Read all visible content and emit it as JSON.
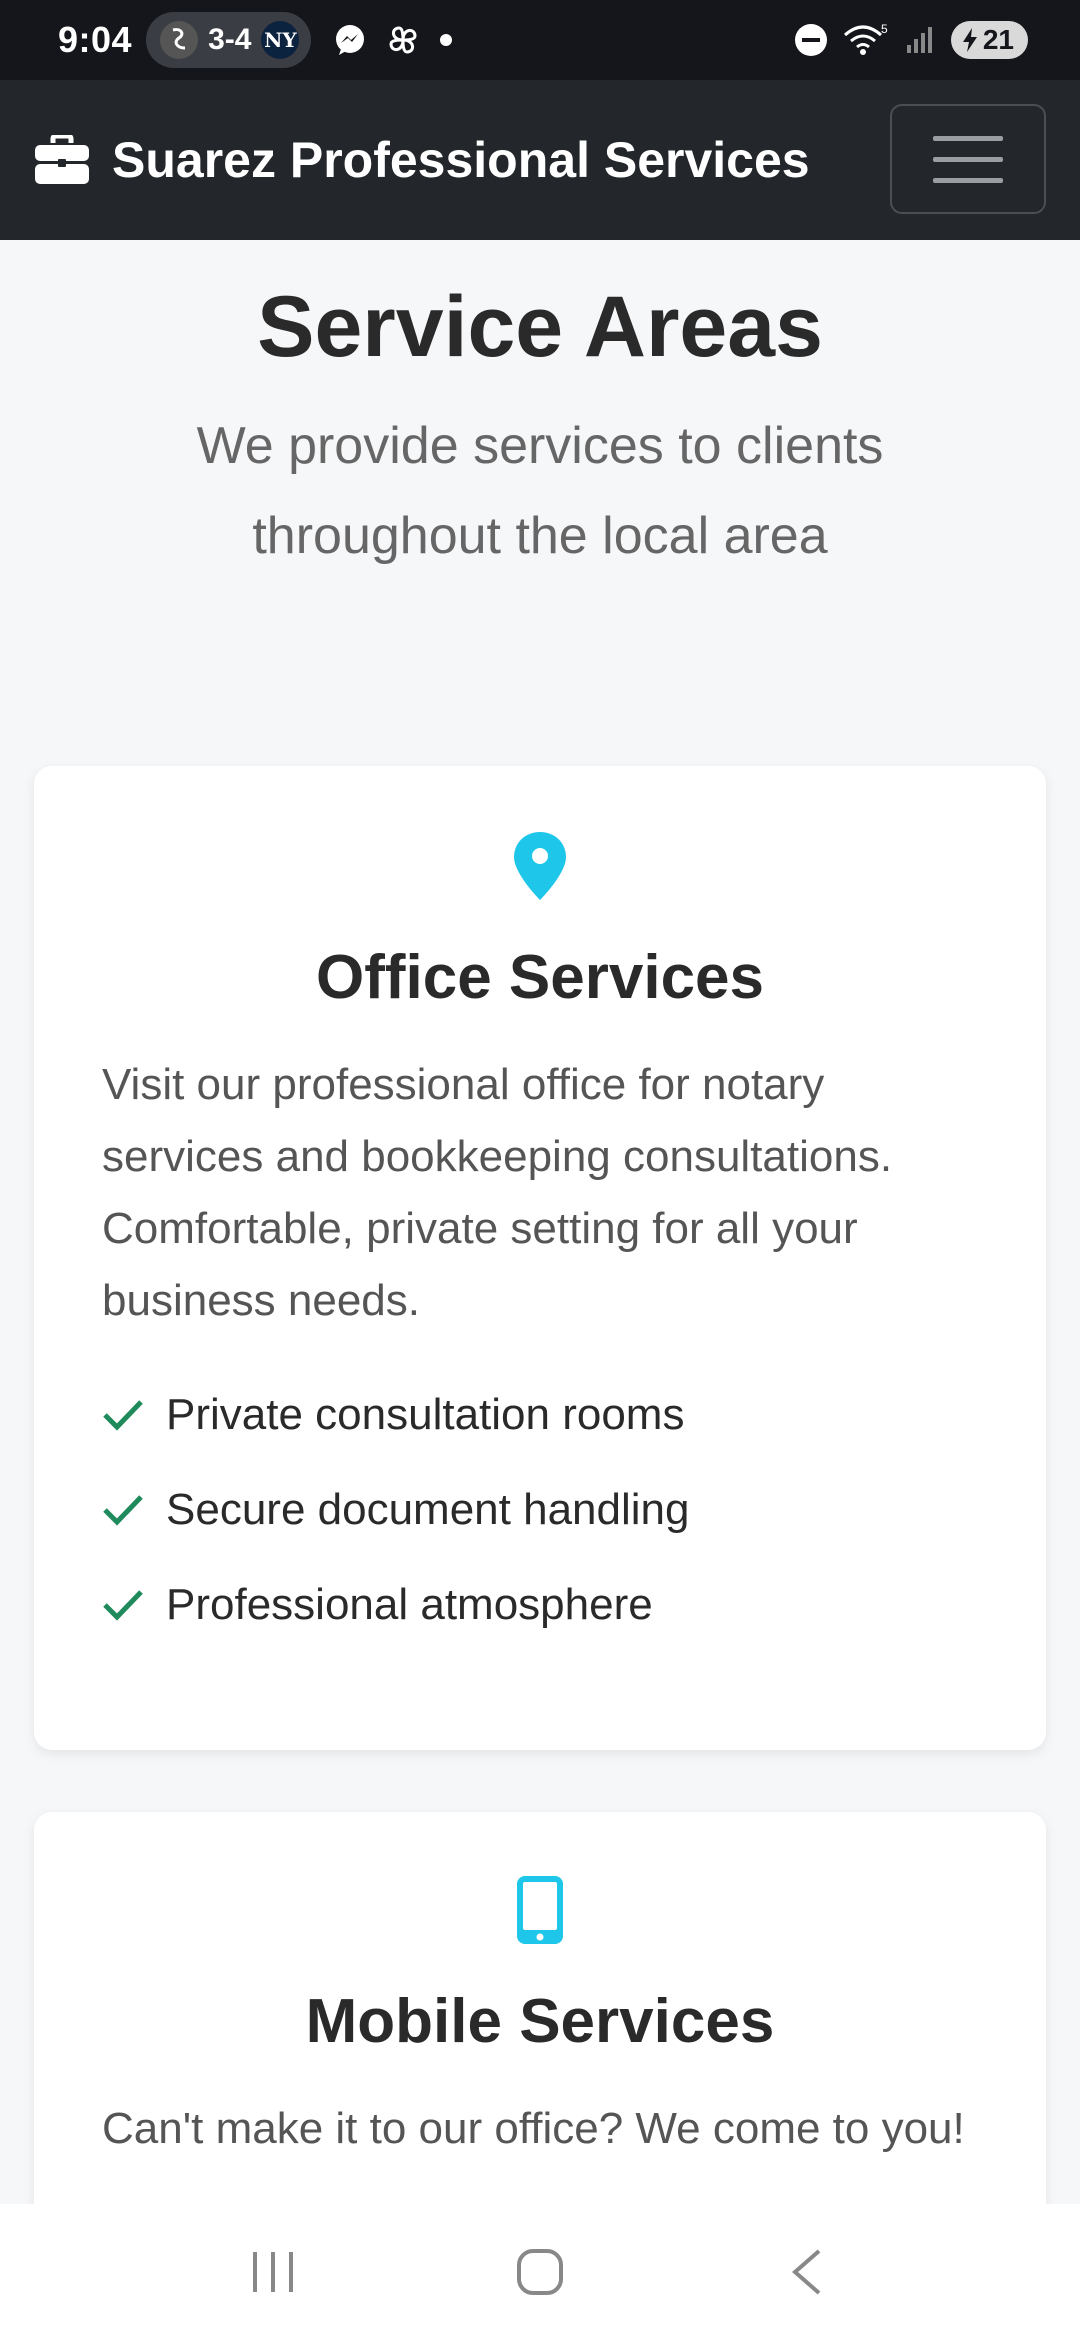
{
  "status_bar": {
    "time": "9:04",
    "score": "3-4",
    "team_a_icon": "white-sox-logo-icon",
    "team_b_icon": "yankees-logo-icon",
    "team_b_mark": "NY",
    "notification_icons": [
      "messenger-icon",
      "pinwheel-icon",
      "dot-icon"
    ],
    "wifi_label": "5",
    "battery": "21"
  },
  "navbar": {
    "brand_icon": "briefcase-icon",
    "brand": "Suarez Professional Services",
    "menu_icon": "hamburger-menu-icon"
  },
  "hero": {
    "title": "Service Areas",
    "subtitle": "We provide services to clients throughout the local area"
  },
  "cards": [
    {
      "icon": "map-marker-icon",
      "title": "Office Services",
      "text": "Visit our professional office for notary services and bookkeeping consultations. Comfortable, private setting for all your business needs.",
      "features": [
        "Private consultation rooms",
        "Secure document handling",
        "Professional atmosphere"
      ]
    },
    {
      "icon": "mobile-phone-icon",
      "title": "Mobile Services",
      "text": "Can't make it to our office? We come to you!"
    }
  ],
  "colors": {
    "accent_icon": "#1ec6ea",
    "check": "#1f8a5b",
    "navbar_bg": "#23272b",
    "status_bg": "#14161b"
  },
  "bottom_nav": [
    "recent-apps-icon",
    "home-icon",
    "back-icon"
  ]
}
